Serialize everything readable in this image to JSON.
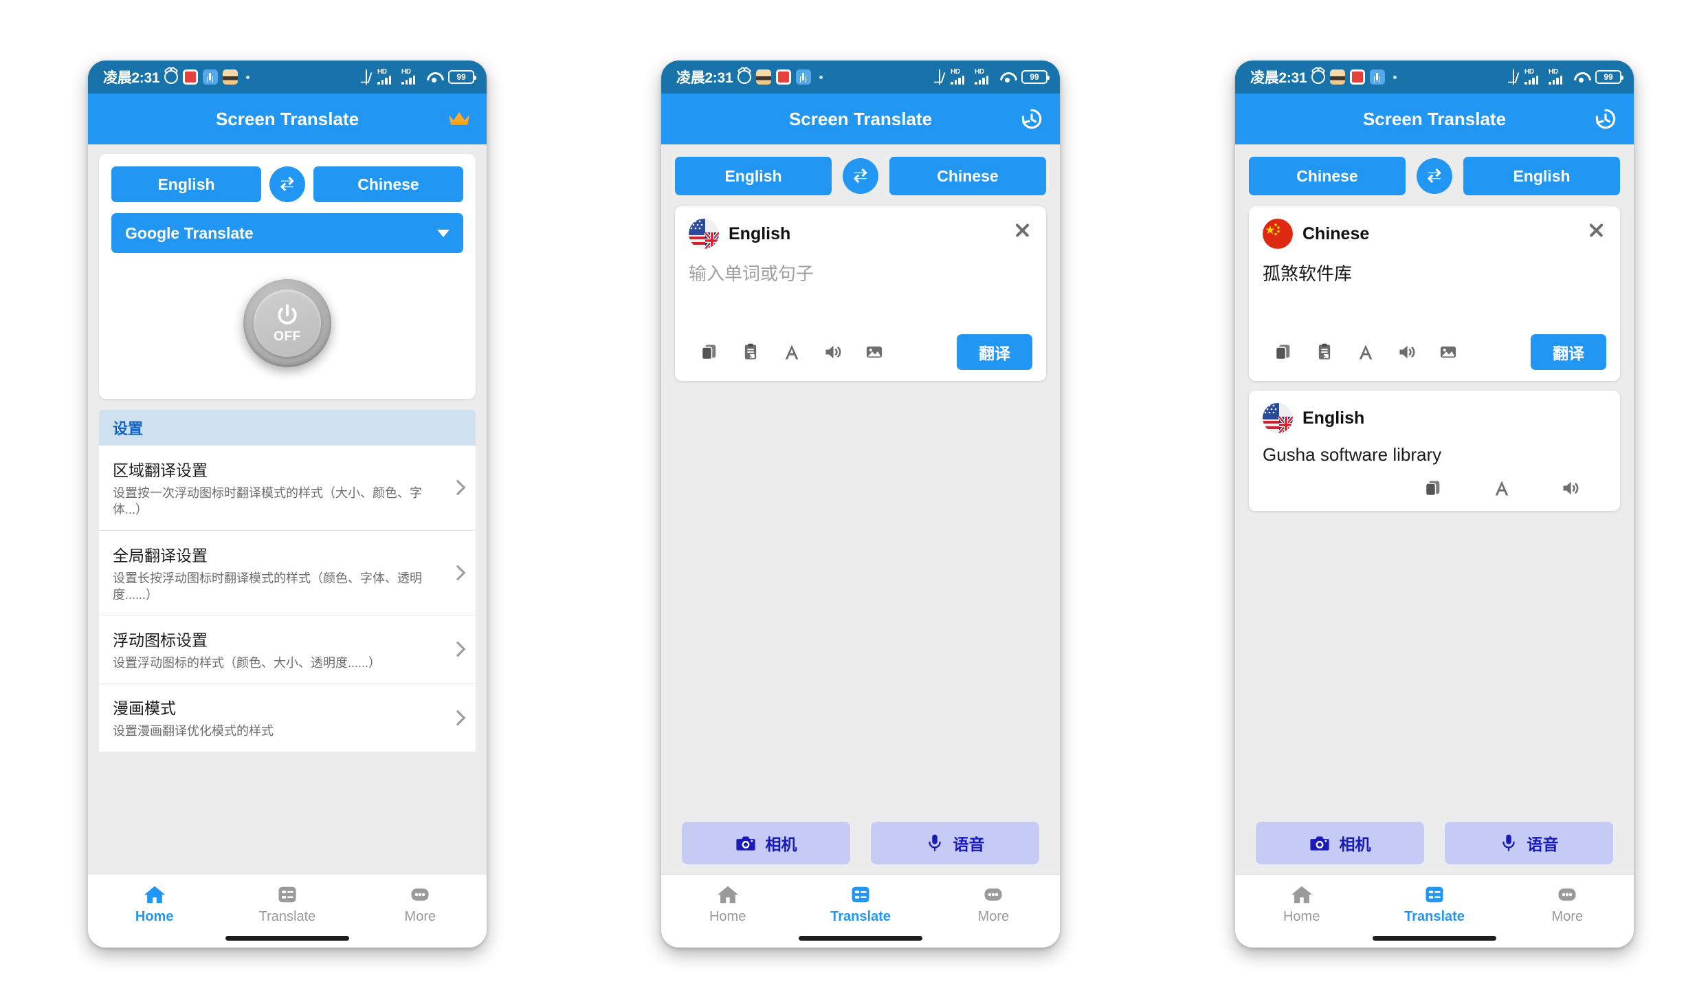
{
  "status_bar": {
    "time": "凌晨2:31",
    "icons_left": [
      "alarm-icon",
      "app-red-icon",
      "app-blue-icon",
      "app-tan-icon",
      "dot-icon"
    ],
    "icons_right": [
      "bluetooth-icon",
      "hd-signal-icon",
      "hd-signal-icon",
      "wifi-icon",
      "battery-icon"
    ],
    "hd_label": "HD",
    "battery_level": "99"
  },
  "app": {
    "title": "Screen Translate",
    "accent_color": "#2196f3",
    "statusbar_color": "#1873ab",
    "crown_color": "#ffa726"
  },
  "phone1": {
    "appbar_action_icon": "crown-icon",
    "source_lang": "English",
    "target_lang": "Chinese",
    "swap_icon": "swap-horizontal-icon",
    "engine": "Google Translate",
    "engine_caret_icon": "caret-down-icon",
    "power_state": "OFF",
    "power_icon": "power-icon",
    "settings_header": "设置",
    "settings": [
      {
        "title": "区域翻译设置",
        "desc": "设置按一次浮动图标时翻译模式的样式（大小、颜色、字体...）"
      },
      {
        "title": "全局翻译设置",
        "desc": "设置长按浮动图标时翻译模式的样式（颜色、字体、透明度......）"
      },
      {
        "title": "浮动图标设置",
        "desc": "设置浮动图标的样式（颜色、大小、透明度......）"
      },
      {
        "title": "漫画模式",
        "desc": "设置漫画翻译优化模式的样式"
      }
    ],
    "nav": [
      {
        "label": "Home",
        "icon": "home-icon",
        "active": true
      },
      {
        "label": "Translate",
        "icon": "translate-icon",
        "active": false
      },
      {
        "label": "More",
        "icon": "more-icon",
        "active": false
      }
    ]
  },
  "phone2": {
    "appbar_action_icon": "history-icon",
    "source_lang": "English",
    "target_lang": "Chinese",
    "swap_icon": "swap-horizontal-icon",
    "card": {
      "flag": "uk-us-flag-icon",
      "lang_label": "English",
      "close_icon": "close-icon",
      "input_placeholder": "输入单词或句子",
      "input_value": "",
      "actions": [
        "copy-icon",
        "paste-icon",
        "font-icon",
        "speaker-icon",
        "image-icon"
      ],
      "translate_label": "翻译"
    },
    "camera_label": "相机",
    "camera_icon": "camera-icon",
    "voice_label": "语音",
    "voice_icon": "microphone-icon",
    "nav": [
      {
        "label": "Home",
        "icon": "home-icon",
        "active": false
      },
      {
        "label": "Translate",
        "icon": "translate-icon",
        "active": true
      },
      {
        "label": "More",
        "icon": "more-icon",
        "active": false
      }
    ]
  },
  "phone3": {
    "appbar_action_icon": "history-icon",
    "source_lang": "Chinese",
    "target_lang": "English",
    "swap_icon": "swap-horizontal-icon",
    "source_card": {
      "flag": "china-flag-icon",
      "lang_label": "Chinese",
      "close_icon": "close-icon",
      "input_value": "孤煞软件库",
      "actions": [
        "copy-icon",
        "paste-icon",
        "font-icon",
        "speaker-icon",
        "image-icon"
      ],
      "translate_label": "翻译"
    },
    "result_card": {
      "flag": "uk-us-flag-icon",
      "lang_label": "English",
      "text": "Gusha software library",
      "actions": [
        "copy-icon",
        "font-icon",
        "speaker-icon"
      ]
    },
    "camera_label": "相机",
    "camera_icon": "camera-icon",
    "voice_label": "语音",
    "voice_icon": "microphone-icon",
    "nav": [
      {
        "label": "Home",
        "icon": "home-icon",
        "active": false
      },
      {
        "label": "Translate",
        "icon": "translate-icon",
        "active": true
      },
      {
        "label": "More",
        "icon": "more-icon",
        "active": false
      }
    ]
  }
}
